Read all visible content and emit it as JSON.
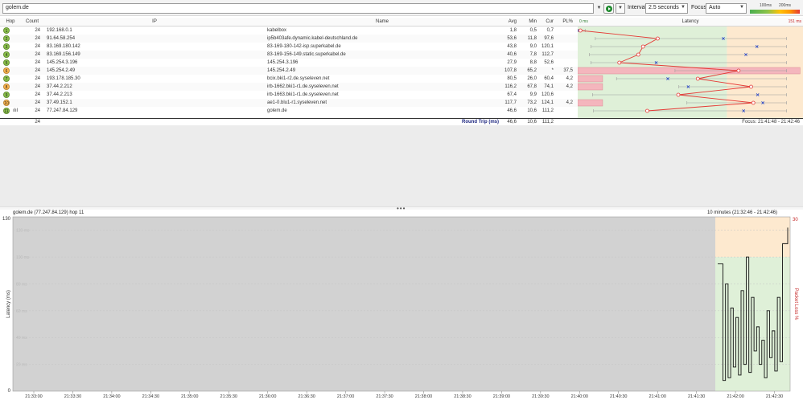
{
  "toolbar": {
    "target": "golem.de",
    "interval_label": "Interval",
    "interval_value": "2.5 seconds",
    "focus_label": "Focus",
    "focus_value": "Auto",
    "legend_100": "100ms",
    "legend_200": "200ms"
  },
  "table": {
    "headers": {
      "hop": "Hop",
      "count": "Count",
      "ip": "IP",
      "name": "Name",
      "avg": "Avg",
      "min": "Min",
      "cur": "Cur",
      "pl": "PL%",
      "latency": "Latency",
      "lat_min": "0 ms",
      "lat_max": "151 ms"
    },
    "rows": [
      {
        "hop": "1",
        "count": "24",
        "ip": "192.168.0.1",
        "name": "kabelbox",
        "avg": "1,8",
        "min": "0,5",
        "cur": "0,7",
        "pl": "",
        "color": "#8bc34a"
      },
      {
        "hop": "2",
        "count": "24",
        "ip": "91.64.58.254",
        "name": "ip5b403afe.dynamic.kabel-deutschland.de",
        "avg": "53,6",
        "min": "11,8",
        "cur": "97,6",
        "pl": "",
        "color": "#8bc34a"
      },
      {
        "hop": "3",
        "count": "24",
        "ip": "83.169.180.142",
        "name": "83-169-180-142-isp.superkabel.de",
        "avg": "43,8",
        "min": "9,0",
        "cur": "120,1",
        "pl": "",
        "color": "#8bc34a"
      },
      {
        "hop": "4",
        "count": "24",
        "ip": "83.169.156.149",
        "name": "83-169-156-149.static.superkabel.de",
        "avg": "40,6",
        "min": "7,8",
        "cur": "112,7",
        "pl": "",
        "color": "#8bc34a"
      },
      {
        "hop": "5",
        "count": "24",
        "ip": "145.254.3.196",
        "name": "145.254.3.196",
        "avg": "27,9",
        "min": "8,8",
        "cur": "52,6",
        "pl": "",
        "color": "#8bc34a"
      },
      {
        "hop": "6",
        "count": "24",
        "ip": "145.254.2.49",
        "name": "145.254.2.49",
        "avg": "107,8",
        "min": "65,2",
        "cur": "*",
        "pl": "37,5",
        "color": "#ffb74d"
      },
      {
        "hop": "7",
        "count": "24",
        "ip": "193.178.185.30",
        "name": "bcix.bki1-r2.de.syseleven.net",
        "avg": "80,5",
        "min": "26,0",
        "cur": "60,4",
        "pl": "4,2",
        "color": "#8bc34a"
      },
      {
        "hop": "8",
        "count": "24",
        "ip": "37.44.2.212",
        "name": "irb-1662.bki1-r1.de.syseleven.net",
        "avg": "116,2",
        "min": "67,8",
        "cur": "74,1",
        "pl": "4,2",
        "color": "#ffb74d"
      },
      {
        "hop": "9",
        "count": "24",
        "ip": "37.44.2.213",
        "name": "irb-1663.bki1-r1.de.syseleven.net",
        "avg": "67,4",
        "min": "9,9",
        "cur": "120,6",
        "pl": "",
        "color": "#8bc34a"
      },
      {
        "hop": "10",
        "count": "24",
        "ip": "37.49.152.1",
        "name": "ae1-0.blu1-r1.syseleven.net",
        "avg": "117,7",
        "min": "73,2",
        "cur": "124,1",
        "pl": "4,2",
        "color": "#ffb74d"
      },
      {
        "hop": "11",
        "count": "24",
        "ip": "77.247.84.129",
        "name": "golem.de",
        "avg": "46,6",
        "min": "10,6",
        "cur": "111,2",
        "pl": "",
        "color": "#8bc34a"
      }
    ],
    "summary": {
      "count": "24",
      "label": "Round Trip (ms)",
      "avg": "46,6",
      "min": "10,6",
      "cur": "111,2",
      "focus": "Focus: 21:41:48 - 21:42:46"
    }
  },
  "latency_chart": {
    "max_ms": 151,
    "green_until_ms": 100,
    "orange_until_ms": 200,
    "hops": [
      {
        "avg": 1.8,
        "min": 0.5,
        "max": 5,
        "cur": 0.7,
        "pl": 0
      },
      {
        "avg": 53.6,
        "min": 11.8,
        "max": 140,
        "cur": 97.6,
        "pl": 0
      },
      {
        "avg": 43.8,
        "min": 9.0,
        "max": 140,
        "cur": 120.1,
        "pl": 0
      },
      {
        "avg": 40.6,
        "min": 7.8,
        "max": 140,
        "cur": 112.7,
        "pl": 0
      },
      {
        "avg": 27.9,
        "min": 8.8,
        "max": 140,
        "cur": 52.6,
        "pl": 0
      },
      {
        "avg": 107.8,
        "min": 65.2,
        "max": 140,
        "cur": null,
        "pl": 37.5
      },
      {
        "avg": 80.5,
        "min": 26.0,
        "max": 140,
        "cur": 60.4,
        "pl": 4.2
      },
      {
        "avg": 116.2,
        "min": 67.8,
        "max": 140,
        "cur": 74.1,
        "pl": 4.2
      },
      {
        "avg": 67.4,
        "min": 9.9,
        "max": 140,
        "cur": 120.6,
        "pl": 0
      },
      {
        "avg": 117.7,
        "min": 73.2,
        "max": 140,
        "cur": 124.1,
        "pl": 4.2
      },
      {
        "avg": 46.6,
        "min": 10.6,
        "max": 140,
        "cur": 111.2,
        "pl": 0
      }
    ]
  },
  "history": {
    "title": "golem.de (77.247.84.129) hop 11",
    "range": "10 minutes (21:32:46 - 21:42:46)",
    "ylabel": "Latency (ms)",
    "y2label": "Packet Loss %",
    "ymax_label": "130",
    "ymin_label": "0",
    "y2max_label": "30",
    "y_ticks": [
      "120 ms",
      "100 ms",
      "80 ms",
      "60 ms",
      "40 ms",
      "20 ms"
    ],
    "x_ticks": [
      "21:33:00",
      "21:33:30",
      "21:34:00",
      "21:34:30",
      "21:35:00",
      "21:35:30",
      "21:36:00",
      "21:36:30",
      "21:37:00",
      "21:37:30",
      "21:38:00",
      "21:38:30",
      "21:39:00",
      "21:39:30",
      "21:40:00",
      "21:40:30",
      "21:41:00",
      "21:41:30",
      "21:42:00",
      "21:42:30"
    ],
    "series": [
      95,
      95,
      8,
      80,
      10,
      62,
      18,
      55,
      12,
      75,
      20,
      100,
      14,
      70,
      30,
      48,
      20,
      38,
      10,
      60,
      25,
      45,
      15,
      70,
      22,
      110,
      110,
      122
    ]
  }
}
